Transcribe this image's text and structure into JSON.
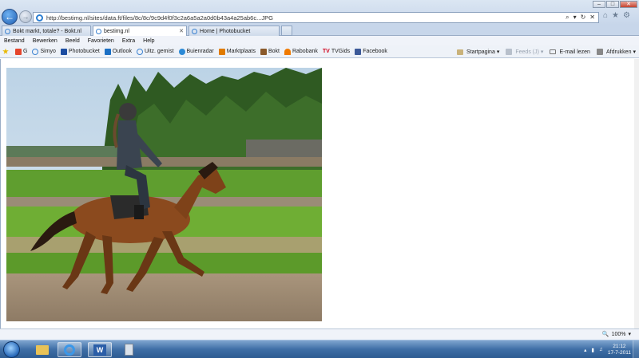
{
  "browser": {
    "address_bar": {
      "url": "http://bestimg.nl/sites/data.ft/files/8c/8c/9c9d4f0f3c2a6a5a2a0d0b43a4a25ab6c...JPG",
      "search_glyph": "⌕",
      "dropdown_glyph": "▾",
      "refresh_glyph": "↻",
      "stop_glyph": "✕"
    },
    "window_controls": {
      "minimize": "–",
      "maximize": "□",
      "close": "✕"
    },
    "tools": {
      "home": "⌂",
      "favorites": "★",
      "settings": "⚙"
    },
    "tabs": [
      {
        "label": "Bokt markt, totale? - Bokt.nl",
        "active": false
      },
      {
        "label": "bestimg.nl",
        "active": true
      },
      {
        "label": "Home | Photobucket",
        "active": false
      }
    ],
    "tab_close": "✕",
    "menu": [
      "Bestand",
      "Bewerken",
      "Beeld",
      "Favorieten",
      "Extra",
      "Help"
    ],
    "favorites_bar": [
      {
        "label": "",
        "icon": "star-icon",
        "color": "#e8b800"
      },
      {
        "label": "G",
        "icon": "google-icon",
        "color": "#e5462d"
      },
      {
        "label": "Simyo",
        "icon": "ie-page-icon",
        "color": "#3b82d0"
      },
      {
        "label": "Photobucket",
        "icon": "photobucket-icon",
        "color": "#1c4da1"
      },
      {
        "label": "Outlook",
        "icon": "outlook-icon",
        "color": "#1a6fc4"
      },
      {
        "label": "Uitz. gemist",
        "icon": "ie-page-icon",
        "color": "#3b82d0"
      },
      {
        "label": "Buienradar",
        "icon": "buienradar-icon",
        "color": "#2c8ad6"
      },
      {
        "label": "Marktplaats",
        "icon": "marktplaats-icon",
        "color": "#e07b00"
      },
      {
        "label": "Bokt",
        "icon": "horse-icon",
        "color": "#8a5a2b"
      },
      {
        "label": "Rabobank",
        "icon": "rabobank-icon",
        "color": "#f07a00"
      },
      {
        "label": "TVGids",
        "icon": "tvgids-icon",
        "color": "#d0021b",
        "prefix": "TV"
      },
      {
        "label": "Facebook",
        "icon": "facebook-icon",
        "color": "#3b5998"
      }
    ],
    "command_bar": [
      {
        "label": "Startpagina",
        "icon": "home-icon",
        "dim": false,
        "dropdown": true
      },
      {
        "label": "Feeds (J)",
        "icon": "feeds-icon",
        "dim": true,
        "dropdown": true
      },
      {
        "label": "E-mail lezen",
        "icon": "mail-icon",
        "dim": false,
        "dropdown": false
      },
      {
        "label": "Afdrukken",
        "icon": "print-icon",
        "dim": false,
        "dropdown": true
      }
    ],
    "status_bar": {
      "zoom": "100%",
      "zoom_dropdown": "▾"
    }
  },
  "taskbar": {
    "apps": [
      {
        "name": "explorer",
        "icon": "folder-icon",
        "active": false
      },
      {
        "name": "internet-explorer",
        "icon": "ie-icon",
        "active": true
      },
      {
        "name": "word",
        "icon": "word-icon",
        "active": true
      },
      {
        "name": "calculator",
        "icon": "calculator-icon",
        "active": false
      }
    ],
    "clock": {
      "time": "21:12",
      "date": "17-7-2011"
    }
  },
  "colors": {
    "accent": "#2c7fd2",
    "taskbar": "#3f6fa6",
    "photo_sky": "#cfe0ee",
    "photo_grass": "#5f9e2f"
  }
}
